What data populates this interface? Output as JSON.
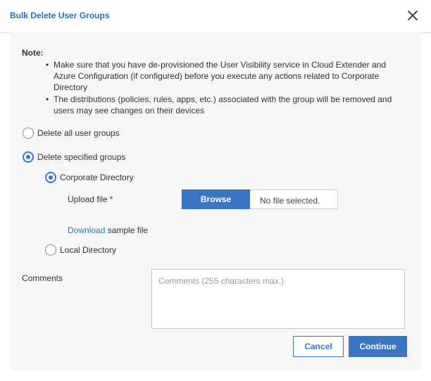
{
  "dialog": {
    "title": "Bulk Delete User Groups",
    "close_icon": "close-icon"
  },
  "note": {
    "label": "Note:",
    "items": [
      "Make sure that you have de-provisioned the User Visibility service in Cloud Extender and Azure Configuration (if configured) before you execute any actions related to Corporate Directory",
      "The distributions (policies, rules, apps, etc.) associated with the group will be removed and users may see changes on their devices"
    ]
  },
  "options": {
    "delete_all": {
      "label": "Delete all user groups",
      "selected": false
    },
    "delete_specified": {
      "label": "Delete specified groups",
      "selected": true
    },
    "corporate_directory": {
      "label": "Corporate Directory",
      "selected": true
    },
    "local_directory": {
      "label": "Local Directory",
      "selected": false
    }
  },
  "upload": {
    "label": "Upload file",
    "required_mark": "*",
    "browse_label": "Browse",
    "file_status": "No file selected.",
    "download_link": "Download",
    "download_suffix": " sample file"
  },
  "comments": {
    "label": "Comments",
    "placeholder": "Comments (255 characters max.)",
    "value": ""
  },
  "buttons": {
    "cancel": "Cancel",
    "continue": "Continue"
  },
  "colors": {
    "accent": "#3a76c4",
    "title": "#2a6ebb",
    "link": "#2a7ab8",
    "required": "#d0021b",
    "panel_bg": "#f6f6f6"
  }
}
